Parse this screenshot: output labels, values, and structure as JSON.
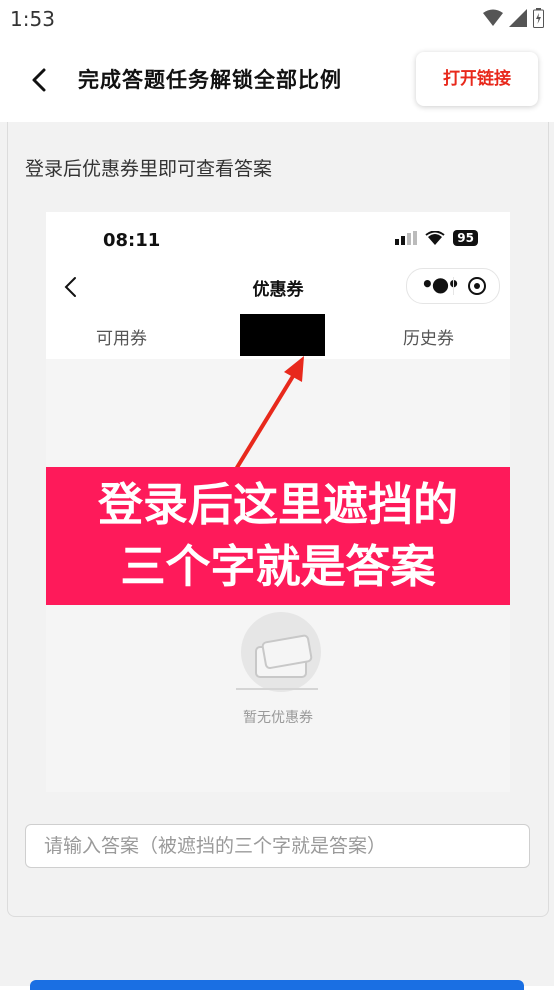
{
  "status_bar": {
    "time": "1:53"
  },
  "header": {
    "title": "完成答题任务解锁全部比例",
    "open_link_label": "打开链接"
  },
  "instruction": "登录后优惠券里即可查看答案",
  "embedded_screenshot": {
    "time": "08:11",
    "battery": "95",
    "page_title": "优惠券",
    "tabs": [
      "可用券",
      "历史券"
    ],
    "banner_line1": "登录后这里遮挡的",
    "banner_line2": "三个字就是答案",
    "empty_text": "暂无优惠券"
  },
  "answer_input": {
    "placeholder": "请输入答案（被遮挡的三个字就是答案）",
    "value": ""
  },
  "colors": {
    "accent_red": "#e8291c",
    "banner_pink": "#fe1a5a",
    "submit_blue": "#1a6fe3"
  }
}
